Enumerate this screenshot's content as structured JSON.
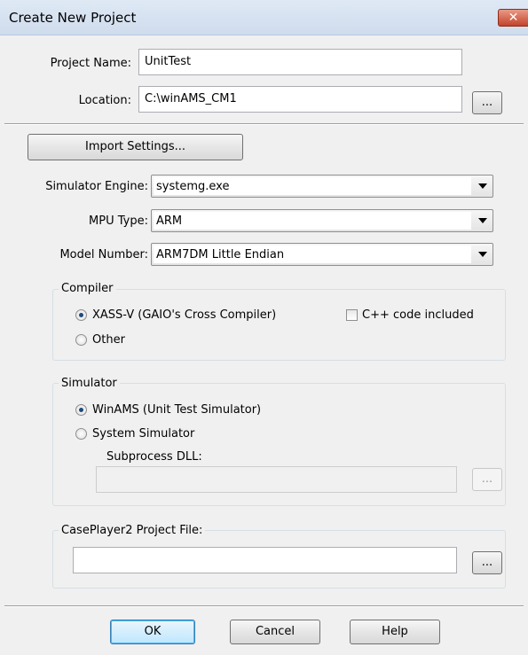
{
  "window": {
    "title": "Create New Project",
    "close_glyph": "✕"
  },
  "project": {
    "name_label": "Project Name:",
    "name_value": "UnitTest",
    "location_label": "Location:",
    "location_value": "C:\\winAMS_CM1",
    "browse_label": "..."
  },
  "import_settings_label": "Import Settings...",
  "simulator_engine": {
    "label": "Simulator Engine:",
    "value": "systemg.exe"
  },
  "mpu_type": {
    "label": "MPU Type:",
    "value": "ARM"
  },
  "model_number": {
    "label": "Model Number:",
    "value": "ARM7DM Little Endian"
  },
  "compiler": {
    "title": "Compiler",
    "options": [
      "XASS-V (GAIO's Cross Compiler)",
      "Other"
    ],
    "selected": 0,
    "cpp_label": "C++ code included",
    "cpp_checked": false
  },
  "simulator": {
    "title": "Simulator",
    "options": [
      "WinAMS (Unit Test Simulator)",
      "System Simulator"
    ],
    "selected": 0,
    "subprocess_label": "Subprocess DLL:",
    "subprocess_value": "",
    "browse_label": "..."
  },
  "caseplayer": {
    "title": "CasePlayer2 Project File:",
    "value": "",
    "browse_label": "..."
  },
  "buttons": {
    "ok": "OK",
    "cancel": "Cancel",
    "help": "Help"
  }
}
